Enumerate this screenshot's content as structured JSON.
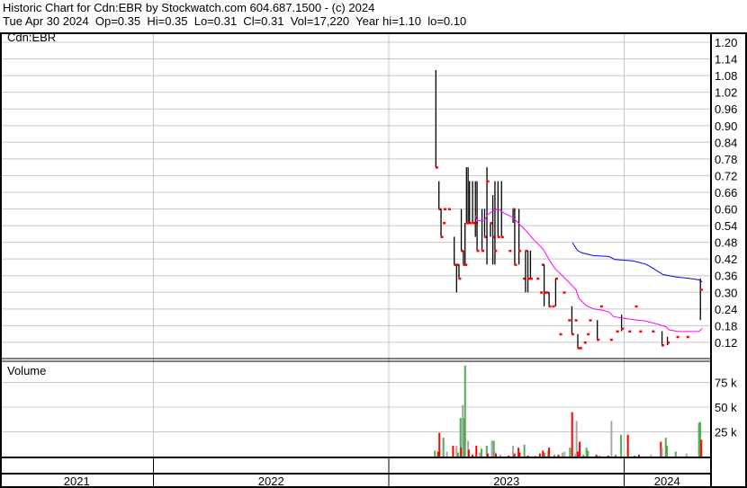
{
  "header": {
    "title": "Historic Chart for Cdn:EBR by Stockwatch.com 604.687.1500 - (c) 2024",
    "quote": "Tue Apr 30 2024  Op=0.35  Hi=0.35  Lo=0.31  Cl=0.31  Vol=17,220  Year hi=1.10  lo=0.10"
  },
  "chart_data": {
    "type": "bar",
    "subtype": "ohlc-with-volume",
    "symbol_label": "Cdn:EBR",
    "volume_label": "Volume",
    "x_unit": "fractional year",
    "xlim": [
      2020.35,
      2023.37
    ],
    "year_labels": [
      {
        "label": "2021",
        "start": 2020.35,
        "end": 2022.0
      },
      {
        "label": "2022",
        "start": 2022.0,
        "end": 2023.0
      },
      {
        "label": "2023",
        "start": 2023.0,
        "end": 2024.0
      },
      {
        "label": "2024",
        "start": 2024.0,
        "end": 2024.37
      }
    ],
    "year_boundaries": [
      2022.0,
      2023.0,
      2024.0
    ],
    "price_axis": {
      "ylim": [
        0.09,
        1.23
      ],
      "ticks": [
        "1.20",
        "1.14",
        "1.08",
        "1.02",
        "0.96",
        "0.90",
        "0.84",
        "0.78",
        "0.72",
        "0.66",
        "0.60",
        "0.54",
        "0.48",
        "0.42",
        "0.36",
        "0.30",
        "0.24",
        "0.18",
        "0.12"
      ]
    },
    "volume_axis": {
      "ylim_k": [
        0,
        92
      ],
      "ticks": [
        {
          "v": 75,
          "label": "75 k"
        },
        {
          "v": 50,
          "label": "50 k"
        },
        {
          "v": 25,
          "label": "25 k"
        }
      ]
    },
    "price_bars": [
      [
        2023.2,
        1.1,
        0.75,
        0.75
      ],
      [
        2023.213,
        0.7,
        0.6,
        0.6
      ],
      [
        2023.222,
        0.6,
        0.5,
        0.5
      ],
      [
        2023.232,
        0.55,
        0.55,
        0.55
      ],
      [
        2023.235,
        0.6,
        0.6,
        0.6
      ],
      [
        2023.254,
        0.6,
        0.6,
        0.6
      ],
      [
        2023.278,
        0.5,
        0.4,
        0.4
      ],
      [
        2023.288,
        0.4,
        0.3,
        0.4
      ],
      [
        2023.298,
        0.4,
        0.35,
        0.35
      ],
      [
        2023.308,
        0.6,
        0.45,
        0.45
      ],
      [
        2023.317,
        0.45,
        0.4,
        0.4
      ],
      [
        2023.324,
        0.55,
        0.4,
        0.4
      ],
      [
        2023.33,
        0.75,
        0.55,
        0.55
      ],
      [
        2023.337,
        0.75,
        0.55,
        0.55
      ],
      [
        2023.343,
        0.7,
        0.55,
        0.55
      ],
      [
        2023.356,
        0.7,
        0.55,
        0.55
      ],
      [
        2023.368,
        0.7,
        0.5,
        0.55
      ],
      [
        2023.375,
        0.7,
        0.45,
        0.45
      ],
      [
        2023.396,
        0.6,
        0.45,
        0.45
      ],
      [
        2023.407,
        0.6,
        0.5,
        0.5
      ],
      [
        2023.417,
        0.75,
        0.4,
        0.7
      ],
      [
        2023.432,
        0.55,
        0.5,
        0.55
      ],
      [
        2023.442,
        0.65,
        0.4,
        0.5
      ],
      [
        2023.451,
        0.7,
        0.4,
        0.45
      ],
      [
        2023.464,
        0.7,
        0.5,
        0.5
      ],
      [
        2023.479,
        0.7,
        0.5,
        0.5
      ],
      [
        2023.512,
        0.45,
        0.45,
        0.45
      ],
      [
        2023.528,
        0.6,
        0.55,
        0.6
      ],
      [
        2023.535,
        0.6,
        0.4,
        0.4
      ],
      [
        2023.553,
        0.6,
        0.4,
        0.45
      ],
      [
        2023.572,
        0.35,
        0.35,
        0.35
      ],
      [
        2023.581,
        0.45,
        0.3,
        0.45
      ],
      [
        2023.591,
        0.45,
        0.3,
        0.35
      ],
      [
        2023.602,
        0.45,
        0.35,
        0.35
      ],
      [
        2023.63,
        0.35,
        0.35,
        0.35
      ],
      [
        2023.645,
        0.3,
        0.3,
        0.3
      ],
      [
        2023.651,
        0.4,
        0.4,
        0.4
      ],
      [
        2023.66,
        0.4,
        0.25,
        0.3
      ],
      [
        2023.67,
        0.3,
        0.3,
        0.3
      ],
      [
        2023.681,
        0.3,
        0.25,
        0.25
      ],
      [
        2023.696,
        0.25,
        0.25,
        0.25
      ],
      [
        2023.709,
        0.35,
        0.25,
        0.35
      ],
      [
        2023.727,
        0.15,
        0.15,
        0.15
      ],
      [
        2023.742,
        0.3,
        0.3,
        0.3
      ],
      [
        2023.764,
        0.2,
        0.2,
        0.2
      ],
      [
        2023.778,
        0.25,
        0.15,
        0.15
      ],
      [
        2023.792,
        0.2,
        0.2,
        0.2
      ],
      [
        2023.803,
        0.15,
        0.1,
        0.1
      ],
      [
        2023.812,
        0.1,
        0.1,
        0.1
      ],
      [
        2023.831,
        0.12,
        0.12,
        0.12
      ],
      [
        2023.844,
        0.15,
        0.15,
        0.15
      ],
      [
        2023.853,
        0.2,
        0.2,
        0.2
      ],
      [
        2023.886,
        0.2,
        0.13,
        0.13
      ],
      [
        2023.9,
        0.25,
        0.25,
        0.25
      ],
      [
        2023.942,
        0.13,
        0.13,
        0.13
      ],
      [
        2023.968,
        0.16,
        0.16,
        0.16
      ],
      [
        2023.989,
        0.22,
        0.16,
        0.17
      ],
      [
        2024.02,
        0.16,
        0.16,
        0.16
      ],
      [
        2024.048,
        0.25,
        0.25,
        0.25
      ],
      [
        2024.066,
        0.16,
        0.16,
        0.16
      ],
      [
        2024.12,
        0.16,
        0.16,
        0.16
      ],
      [
        2024.161,
        0.16,
        0.11,
        0.11
      ],
      [
        2024.184,
        0.14,
        0.11,
        0.12
      ],
      [
        2024.224,
        0.14,
        0.14,
        0.14
      ],
      [
        2024.267,
        0.14,
        0.14,
        0.14
      ],
      [
        2024.324,
        0.35,
        0.2,
        0.31
      ]
    ],
    "ma_short": {
      "color": "#ff00ff",
      "points": [
        [
          2023.368,
          0.576
        ],
        [
          2023.375,
          0.558
        ],
        [
          2023.407,
          0.558
        ],
        [
          2023.42,
          0.58
        ],
        [
          2023.438,
          0.59
        ],
        [
          2023.464,
          0.601
        ],
        [
          2023.49,
          0.585
        ],
        [
          2023.528,
          0.569
        ],
        [
          2023.553,
          0.547
        ],
        [
          2023.585,
          0.52
        ],
        [
          2023.617,
          0.488
        ],
        [
          2023.655,
          0.456
        ],
        [
          2023.681,
          0.418
        ],
        [
          2023.706,
          0.386
        ],
        [
          2023.738,
          0.359
        ],
        [
          2023.77,
          0.332
        ],
        [
          2023.795,
          0.31
        ],
        [
          2023.808,
          0.278
        ],
        [
          2023.84,
          0.251
        ],
        [
          2023.872,
          0.24
        ],
        [
          2023.91,
          0.235
        ],
        [
          2023.936,
          0.229
        ],
        [
          2023.955,
          0.213
        ],
        [
          2023.987,
          0.208
        ],
        [
          2024.037,
          0.202
        ],
        [
          2024.089,
          0.197
        ],
        [
          2024.14,
          0.186
        ],
        [
          2024.178,
          0.176
        ],
        [
          2024.191,
          0.165
        ],
        [
          2024.229,
          0.159
        ],
        [
          2024.318,
          0.159
        ],
        [
          2024.331,
          0.17
        ]
      ]
    },
    "ma_long": {
      "color": "#0000ff",
      "points": [
        [
          2023.78,
          0.479
        ],
        [
          2023.802,
          0.45
        ],
        [
          2023.821,
          0.442
        ],
        [
          2023.872,
          0.432
        ],
        [
          2023.936,
          0.429
        ],
        [
          2023.961,
          0.418
        ],
        [
          2024.037,
          0.413
        ],
        [
          2024.089,
          0.402
        ],
        [
          2024.114,
          0.391
        ],
        [
          2024.165,
          0.364
        ],
        [
          2024.216,
          0.356
        ],
        [
          2024.293,
          0.348
        ],
        [
          2024.318,
          0.345
        ],
        [
          2024.331,
          0.337
        ]
      ]
    },
    "volume_k": [
      [
        2023.196,
        6,
        "up"
      ],
      [
        2023.209,
        5,
        "down"
      ],
      [
        2023.215,
        24,
        "down"
      ],
      [
        2023.232,
        19,
        "up"
      ],
      [
        2023.247,
        5,
        "flat"
      ],
      [
        2023.273,
        11,
        "down"
      ],
      [
        2023.288,
        11,
        "flat"
      ],
      [
        2023.294,
        4,
        "up"
      ],
      [
        2023.305,
        39,
        "up"
      ],
      [
        2023.307,
        9,
        "down"
      ],
      [
        2023.314,
        52,
        "flat"
      ],
      [
        2023.32,
        39,
        "up"
      ],
      [
        2023.324,
        92,
        "up"
      ],
      [
        2023.337,
        16,
        "flat"
      ],
      [
        2023.34,
        7,
        "down"
      ],
      [
        2023.356,
        2,
        "down"
      ],
      [
        2023.372,
        11,
        "down"
      ],
      [
        2023.387,
        4,
        "flat"
      ],
      [
        2023.394,
        8,
        "up"
      ],
      [
        2023.416,
        11,
        "up"
      ],
      [
        2023.421,
        3,
        "down"
      ],
      [
        2023.438,
        16,
        "flat"
      ],
      [
        2023.446,
        16,
        "up"
      ],
      [
        2023.451,
        5,
        "flat"
      ],
      [
        2023.455,
        3,
        "down"
      ],
      [
        2023.474,
        2,
        "flat"
      ],
      [
        2023.509,
        1,
        "down"
      ],
      [
        2023.528,
        11,
        "flat"
      ],
      [
        2023.534,
        3,
        "down"
      ],
      [
        2023.551,
        9,
        "down"
      ],
      [
        2023.556,
        4,
        "down"
      ],
      [
        2023.576,
        12,
        "up"
      ],
      [
        2023.591,
        1,
        "down"
      ],
      [
        2023.623,
        1,
        "flat"
      ],
      [
        2023.642,
        3,
        "down"
      ],
      [
        2023.655,
        6,
        "down"
      ],
      [
        2023.662,
        4,
        "up"
      ],
      [
        2023.676,
        6,
        "flat"
      ],
      [
        2023.681,
        9,
        "down"
      ],
      [
        2023.704,
        2,
        "up"
      ],
      [
        2023.721,
        2,
        "down"
      ],
      [
        2023.738,
        4,
        "flat"
      ],
      [
        2023.747,
        5,
        "flat"
      ],
      [
        2023.77,
        9,
        "up"
      ],
      [
        2023.779,
        45,
        "down"
      ],
      [
        2023.793,
        3,
        "flat"
      ],
      [
        2023.798,
        36,
        "flat"
      ],
      [
        2023.803,
        5,
        "down"
      ],
      [
        2023.811,
        15,
        "down"
      ],
      [
        2023.827,
        2,
        "up"
      ],
      [
        2023.84,
        9,
        "up"
      ],
      [
        2023.846,
        6,
        "up"
      ],
      [
        2023.882,
        2,
        "down"
      ],
      [
        2023.895,
        1,
        "up"
      ],
      [
        2023.932,
        1,
        "down"
      ],
      [
        2023.946,
        36,
        "flat"
      ],
      [
        2023.964,
        2,
        "up"
      ],
      [
        2023.987,
        22,
        "up"
      ],
      [
        2024.016,
        22,
        "down"
      ],
      [
        2024.044,
        1,
        "up"
      ],
      [
        2024.063,
        2,
        "down"
      ],
      [
        2024.114,
        2,
        "flat"
      ],
      [
        2024.156,
        15,
        "down"
      ],
      [
        2024.161,
        9,
        "flat"
      ],
      [
        2024.177,
        19,
        "up"
      ],
      [
        2024.182,
        11,
        "up"
      ],
      [
        2024.219,
        5,
        "up"
      ],
      [
        2024.265,
        3,
        "flat"
      ],
      [
        2024.318,
        34,
        "up"
      ],
      [
        2024.323,
        35,
        "up"
      ],
      [
        2024.328,
        17,
        "down"
      ]
    ],
    "colors": {
      "up": "#4caf50",
      "down": "#ff0000",
      "flat": "#a8a8a8",
      "bar": "#000000",
      "close_tick": "#ff0000",
      "grid": "#c8c8c8"
    }
  }
}
